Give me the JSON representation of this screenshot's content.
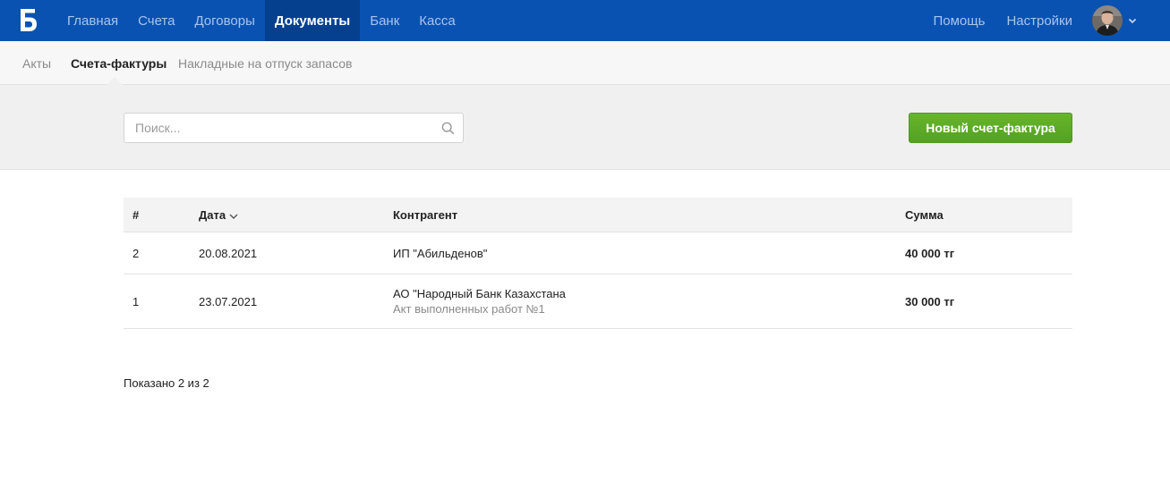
{
  "header": {
    "logo_letter": "Б",
    "nav": [
      {
        "label": "Главная",
        "active": false
      },
      {
        "label": "Счета",
        "active": false
      },
      {
        "label": "Договоры",
        "active": false
      },
      {
        "label": "Документы",
        "active": true
      },
      {
        "label": "Банк",
        "active": false
      },
      {
        "label": "Касса",
        "active": false
      }
    ],
    "help_label": "Помощь",
    "settings_label": "Настройки",
    "profile_menu_icon": "chevron-down-icon",
    "brand_color": "#0a52b1",
    "active_nav_color": "#04408e"
  },
  "subtabs": [
    {
      "label": "Акты",
      "active": false
    },
    {
      "label": "Счета-фактуры",
      "active": true
    },
    {
      "label": "Накладные на отпуск запасов",
      "active": false
    }
  ],
  "toolbar": {
    "search_placeholder": "Поиск...",
    "search_icon": "search-icon",
    "new_button_label": "Новый счет-фактура",
    "new_button_color": "#5cab24"
  },
  "table": {
    "columns": [
      "#",
      "Дата",
      "Контрагент",
      "Сумма"
    ],
    "sorted_by": "Дата",
    "rows": [
      {
        "num": "2",
        "date": "20.08.2021",
        "counterparty": "ИП \"Абильденов\"",
        "note": "",
        "amount": "40 000 тг"
      },
      {
        "num": "1",
        "date": "23.07.2021",
        "counterparty": "АО \"Народный Банк Казахстана",
        "note": "Акт выполненных работ №1",
        "amount": "30 000 тг"
      }
    ]
  },
  "footer": {
    "count_text": "Показано 2 из 2"
  }
}
